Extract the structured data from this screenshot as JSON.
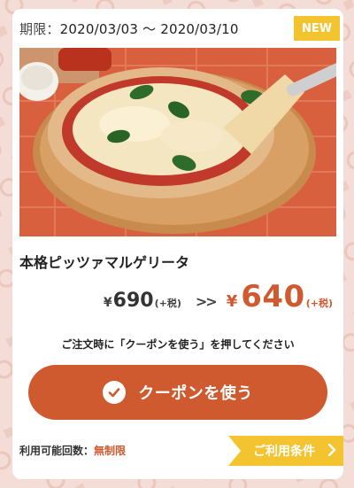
{
  "coupon": {
    "period_label": "期限：",
    "period_dates": "2020/03/03 〜 2020/03/10",
    "badge": "NEW",
    "title": "本格ピッツァマルゲリータ",
    "old_price": {
      "yen": "¥",
      "amount": "690",
      "tax": "(+税)"
    },
    "arrows": ">>",
    "new_price": {
      "yen": "¥",
      "amount": "640",
      "tax": "(+税)"
    },
    "instruction": "ご注文時に「クーポンを使う」を押してください",
    "use_button_label": "クーポンを使う",
    "usage_label": "利用可能回数：",
    "usage_value": "無制限",
    "terms_label": "ご利用条件"
  },
  "icons": [
    "check-circle-icon",
    "chevron-right-icon"
  ],
  "colors": {
    "accent": "#cf5a2f",
    "badge": "#f4c430",
    "background": "#f4ddd6"
  }
}
